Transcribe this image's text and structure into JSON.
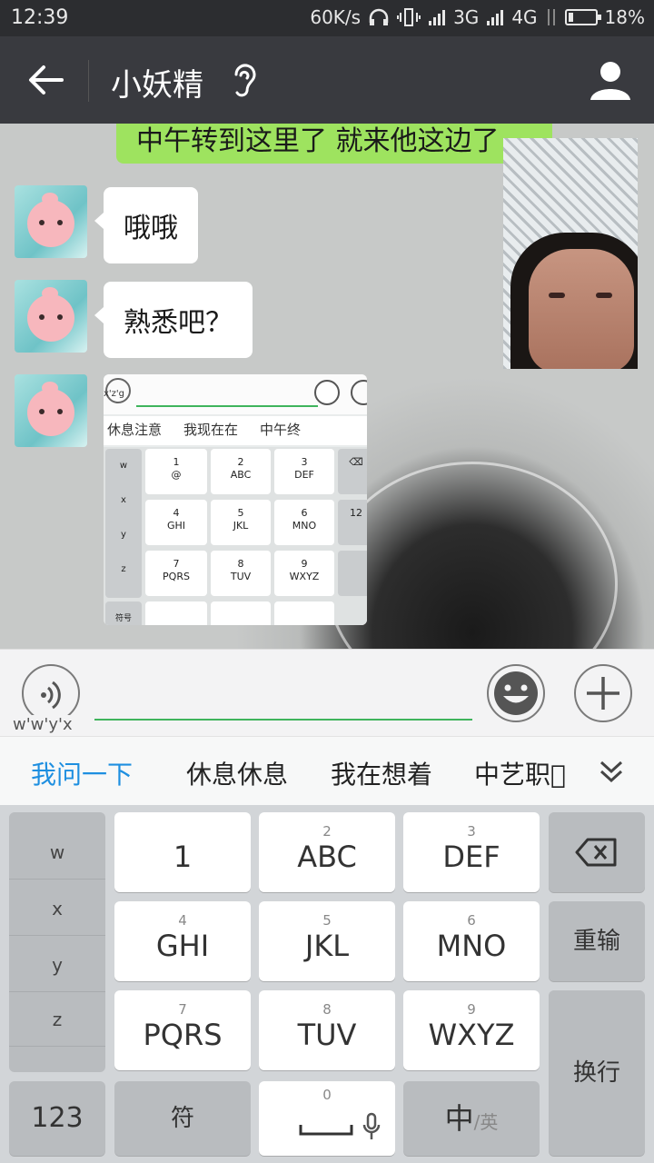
{
  "status_bar": {
    "time": "12:39",
    "speed": "60K/s",
    "net1": "3G",
    "net2": "4G",
    "battery": "18%",
    "battery_level": 0.18
  },
  "header": {
    "title": "小妖精"
  },
  "messages": {
    "outgoing_text": "中午转到这里了 就来他这边了",
    "incoming_1": "哦哦",
    "incoming_2": "熟悉吧？"
  },
  "image_message": {
    "composing": "x'z'g",
    "candidates": [
      "休息注意",
      "我现在在",
      "中午终"
    ],
    "keys": [
      {
        "num": "1",
        "label": "@"
      },
      {
        "num": "2",
        "label": "ABC"
      },
      {
        "num": "3",
        "label": "DEF"
      },
      {
        "num": "4",
        "label": "GHI"
      },
      {
        "num": "5",
        "label": "JKL"
      },
      {
        "num": "6",
        "label": "MNO"
      },
      {
        "num": "7",
        "label": "PQRS"
      },
      {
        "num": "8",
        "label": "TUV"
      },
      {
        "num": "9",
        "label": "WXYZ"
      }
    ],
    "left_letters": [
      "w",
      "x",
      "y",
      "z"
    ],
    "side": "12",
    "bottom_left": "符号"
  },
  "input_bar": {
    "composing": "w'w'y'x"
  },
  "candidate_bar": {
    "items": [
      "我问一下",
      "休息休息",
      "我在想着",
      "中艺职\u0000"
    ]
  },
  "keyboard": {
    "left_column": [
      "w",
      "x",
      "y",
      "z"
    ],
    "keys": {
      "k1": {
        "num": "",
        "label": "1"
      },
      "k2": {
        "num": "2",
        "label": "ABC"
      },
      "k3": {
        "num": "3",
        "label": "DEF"
      },
      "k4": {
        "num": "4",
        "label": "GHI"
      },
      "k5": {
        "num": "5",
        "label": "JKL"
      },
      "k6": {
        "num": "6",
        "label": "MNO"
      },
      "k7": {
        "num": "7",
        "label": "PQRS"
      },
      "k8": {
        "num": "8",
        "label": "TUV"
      },
      "k9": {
        "num": "9",
        "label": "WXYZ"
      },
      "k0": {
        "num": "0"
      }
    },
    "reinput": "重输",
    "newline": "换行",
    "numbers": "123",
    "symbols": "符",
    "lang_main": "中",
    "lang_alt": "/英"
  },
  "colors": {
    "accent_green": "#3fb45c",
    "candidate_blue": "#1e8fe0",
    "title_bar": "#393a3f"
  }
}
